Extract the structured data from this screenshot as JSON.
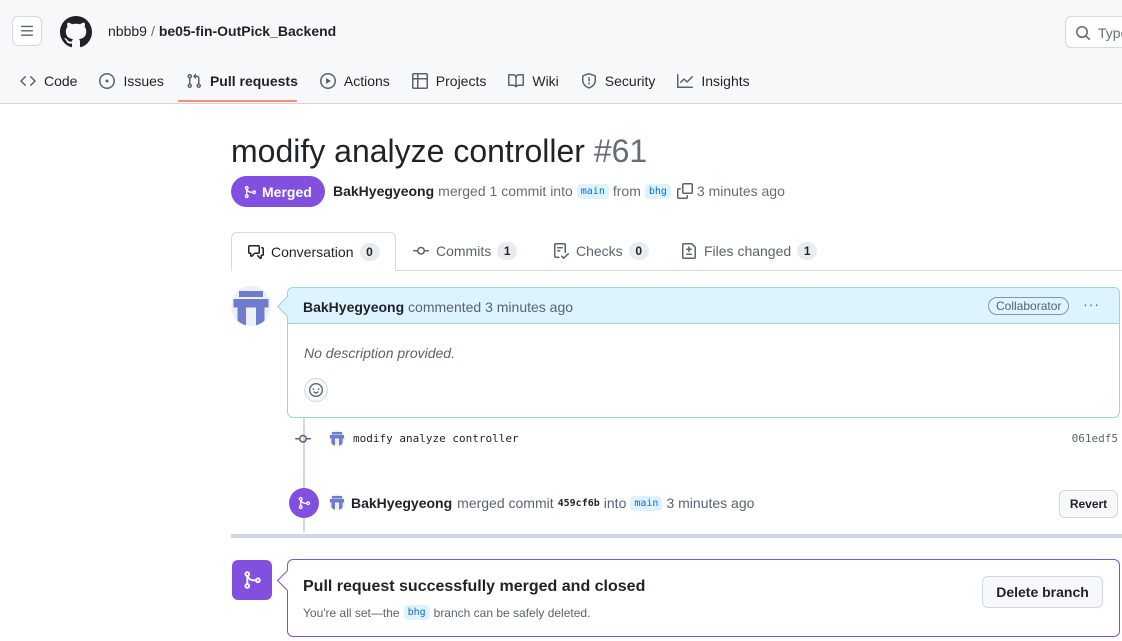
{
  "header": {
    "owner": "nbbb9",
    "separator": "/",
    "repo": "be05-fin-OutPick_Backend",
    "search_placeholder": "Type"
  },
  "repo_nav": [
    {
      "label": "Code",
      "icon": "code-icon",
      "active": false
    },
    {
      "label": "Issues",
      "icon": "issue-icon",
      "active": false
    },
    {
      "label": "Pull requests",
      "icon": "pull-request-icon",
      "active": true
    },
    {
      "label": "Actions",
      "icon": "play-icon",
      "active": false
    },
    {
      "label": "Projects",
      "icon": "table-icon",
      "active": false
    },
    {
      "label": "Wiki",
      "icon": "book-icon",
      "active": false
    },
    {
      "label": "Security",
      "icon": "shield-icon",
      "active": false
    },
    {
      "label": "Insights",
      "icon": "graph-icon",
      "active": false
    }
  ],
  "pr": {
    "title": "modify analyze controller",
    "number": "#61",
    "state": "Merged",
    "author": "BakHyegyeong",
    "merged_text": "merged 1 commit into",
    "base_branch": "main",
    "from_text": "from",
    "head_branch": "bhg",
    "time": "3 minutes ago"
  },
  "tabs": [
    {
      "label": "Conversation",
      "count": "0",
      "icon": "comment-discussion-icon"
    },
    {
      "label": "Commits",
      "count": "1",
      "icon": "commit-icon"
    },
    {
      "label": "Checks",
      "count": "0",
      "icon": "checklist-icon"
    },
    {
      "label": "Files changed",
      "count": "1",
      "icon": "diff-icon"
    }
  ],
  "comment": {
    "author": "BakHyegyeong",
    "action": "commented 3 minutes ago",
    "badge": "Collaborator",
    "more": "···",
    "body": "No description provided."
  },
  "commit": {
    "message": "modify analyze controller",
    "sha": "061edf5"
  },
  "merge_event": {
    "author": "BakHyegyeong",
    "text1": "merged commit",
    "sha": "459cf6b",
    "text2": "into",
    "branch": "main",
    "time": "3 minutes ago",
    "revert_label": "Revert"
  },
  "merged_box": {
    "title": "Pull request successfully merged and closed",
    "sub_prefix": "You're all set—the",
    "branch": "bhg",
    "sub_suffix": "branch can be safely deleted.",
    "delete_label": "Delete branch"
  },
  "colors": {
    "merged_purple": "#8250df",
    "comment_header_bg": "#ddf4ff",
    "branch_blue": "#0969da",
    "nav_underline": "#fd8c73"
  }
}
